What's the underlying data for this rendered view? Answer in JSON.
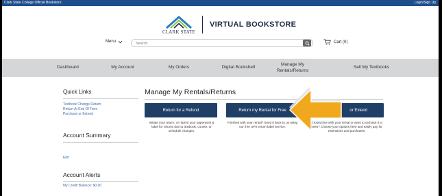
{
  "topbar": {
    "left": "Clark State College Official Bookstore",
    "right": "Login/Sign Up"
  },
  "logo": {
    "college": "CLARK STATE",
    "store": "VIRTUAL BOOKSTORE"
  },
  "header": {
    "menu_label": "Menu",
    "search_placeholder": "Search",
    "cart_label": "Cart (0)"
  },
  "nav": {
    "items": [
      {
        "label": "Dashboard"
      },
      {
        "label": "My Account"
      },
      {
        "label": "My Orders"
      },
      {
        "label": "Digital Bookshelf"
      },
      {
        "label": "Manage My Rentals/Returns"
      },
      {
        "label": "Sell My Textbooks"
      }
    ]
  },
  "sidebar": {
    "quick_links_title": "Quick Links",
    "links": [
      {
        "label": "Textbook Change Return"
      },
      {
        "label": "Return At End Of Term"
      },
      {
        "label": "Purchase or Extend"
      }
    ],
    "account_summary_title": "Account Summary",
    "edit_label": "Edit",
    "alerts_title": "Account Alerts",
    "credit_label": "My Credit Balance: $0.00"
  },
  "main": {
    "title": "Manage My Rentals/Returns",
    "buttons": [
      {
        "label": "Return for a Refund"
      },
      {
        "label": "Return my Rental for Free"
      },
      {
        "label": "or Extend"
      }
    ],
    "descriptions": [
      {
        "text": "Initiate your return, or reprint your paperwork & label for returns due to textbook, course, or schedule changes."
      },
      {
        "text": "Finished with your rental? Send it back to us using our free UPS return label service."
      },
      {
        "text": "d extra time with your rental or want to urchase it to keep? Choose your options here and easily pay for extensions and purchases."
      }
    ]
  },
  "colors": {
    "topbar": "#1f4e8c",
    "button": "#1f3f66",
    "nav": "#d4d6d8",
    "link": "#3a6ea5",
    "arrow": "#f0a81c"
  }
}
